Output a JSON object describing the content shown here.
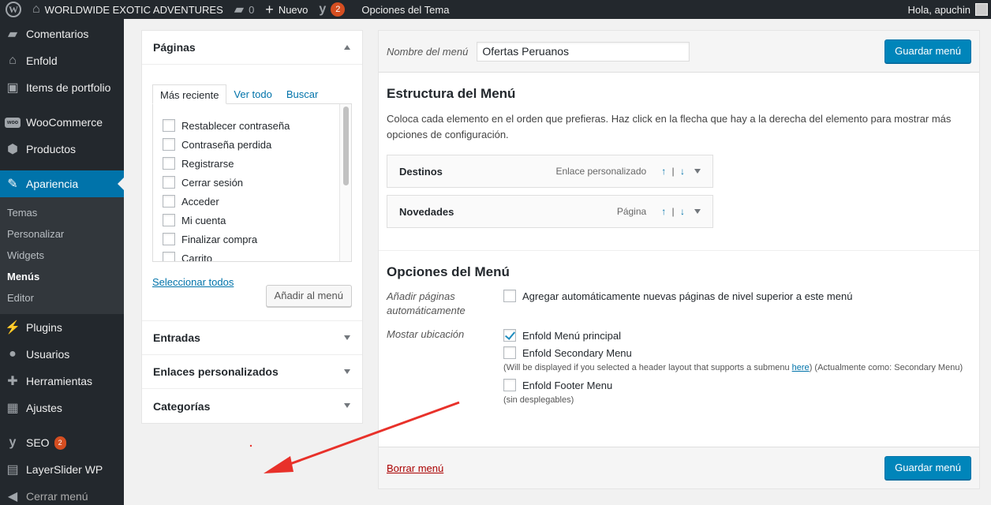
{
  "adminbar": {
    "site_name": "WORLDWIDE EXOTIC ADVENTURES",
    "comments_count": "0",
    "new_label": "Nuevo",
    "yoast_count": "2",
    "theme_options": "Opciones del Tema",
    "greeting": "Hola, apuchin"
  },
  "sidebar": {
    "items": [
      {
        "label": "Comentarios",
        "icon": "comment-icon"
      },
      {
        "label": "Enfold",
        "icon": "home-icon"
      },
      {
        "label": "Items de portfolio",
        "icon": "portfolio-icon"
      },
      {
        "label": "WooCommerce",
        "icon": "woocommerce-icon"
      },
      {
        "label": "Productos",
        "icon": "box-icon"
      },
      {
        "label": "Apariencia",
        "icon": "brush-icon"
      },
      {
        "label": "Plugins",
        "icon": "plugin-icon"
      },
      {
        "label": "Usuarios",
        "icon": "users-icon"
      },
      {
        "label": "Herramientas",
        "icon": "wrench-icon"
      },
      {
        "label": "Ajustes",
        "icon": "settings-icon"
      },
      {
        "label": "SEO",
        "icon": "yoast-icon",
        "badge": "2"
      },
      {
        "label": "LayerSlider WP",
        "icon": "layers-icon"
      },
      {
        "label": "Cerrar menú",
        "icon": "collapse-icon"
      }
    ],
    "submenu": [
      "Temas",
      "Personalizar",
      "Widgets",
      "Menús",
      "Editor"
    ]
  },
  "left_panel": {
    "pages_title": "Páginas",
    "tabs": [
      "Más reciente",
      "Ver todo",
      "Buscar"
    ],
    "pages": [
      "Restablecer contraseña",
      "Contraseña perdida",
      "Registrarse",
      "Cerrar sesión",
      "Acceder",
      "Mi cuenta",
      "Finalizar compra",
      "Carrito"
    ],
    "select_all": "Seleccionar todos",
    "add_button": "Añadir al menú",
    "sections": [
      "Entradas",
      "Enlaces personalizados",
      "Categorías"
    ]
  },
  "right_panel": {
    "menu_name_label": "Nombre del menú",
    "menu_name_value": "Ofertas Peruanos",
    "save_label": "Guardar menú",
    "structure_title": "Estructura del Menú",
    "structure_desc": "Coloca cada elemento en el orden que prefieras. Haz click en la flecha que hay a la derecha del elemento para mostrar más opciones de configuración.",
    "menu_items": [
      {
        "title": "Destinos",
        "type": "Enlace personalizado"
      },
      {
        "title": "Novedades",
        "type": "Página"
      }
    ],
    "arrow_up": "↑",
    "arrow_sep": "|",
    "arrow_down": "↓",
    "options_title": "Opciones del Menú",
    "auto_add_label": "Añadir páginas automáticamente",
    "auto_add_text": "Agregar automáticamente nuevas páginas de nivel superior a este menú",
    "location_label": "Mostar ubicación",
    "locations": {
      "primary": "Enfold Menú principal",
      "secondary": "Enfold Secondary Menu",
      "secondary_note_before": "(Will be displayed if you selected a header layout that supports a submenu ",
      "secondary_note_link": "here",
      "secondary_note_after": ") (Actualmente como: Secondary Menu)",
      "footer": "Enfold Footer Menu",
      "footer_note": "(sin desplegables)"
    },
    "delete_label": "Borrar menú"
  },
  "colors": {
    "accent": "#0073aa",
    "primary_button": "#0085ba",
    "admin_dark": "#23282d",
    "badge": "#d54e21",
    "annotation_arrow": "#e8312a"
  }
}
